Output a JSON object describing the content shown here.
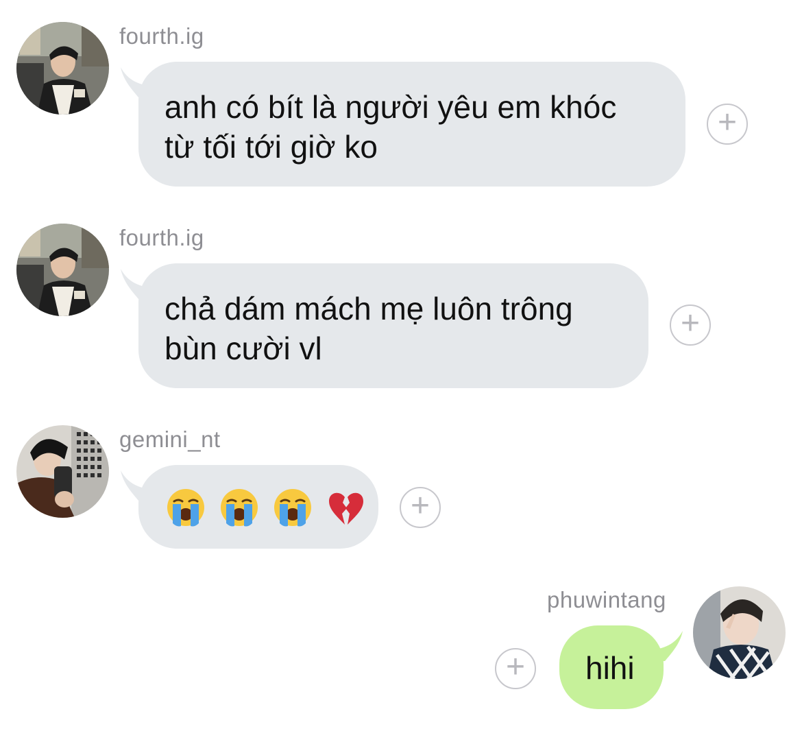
{
  "messages": [
    {
      "username": "fourth.ig",
      "text": "anh có bít là người yêu em khóc\ntừ tối tới giờ ko",
      "avatar": "avatar-fourth"
    },
    {
      "username": "fourth.ig",
      "text": "chả dám mách mẹ luôn trông\nbùn cười vl",
      "avatar": "avatar-fourth"
    },
    {
      "username": "gemini_nt",
      "emojis": [
        "loudly-crying-face",
        "loudly-crying-face",
        "loudly-crying-face",
        "broken-heart"
      ],
      "avatar": "avatar-gemini"
    },
    {
      "username": "phuwintang",
      "text": "hihi",
      "avatar": "avatar-phuwin"
    }
  ],
  "actions": {
    "add_reaction_icon": "plus-circle-icon",
    "add_reaction_glyph": "+"
  },
  "colors": {
    "incoming_bubble": "#e5e8eb",
    "outgoing_bubble": "#c6f19a",
    "username_text": "#8e8e93",
    "plus_border": "#c7c7cc"
  }
}
